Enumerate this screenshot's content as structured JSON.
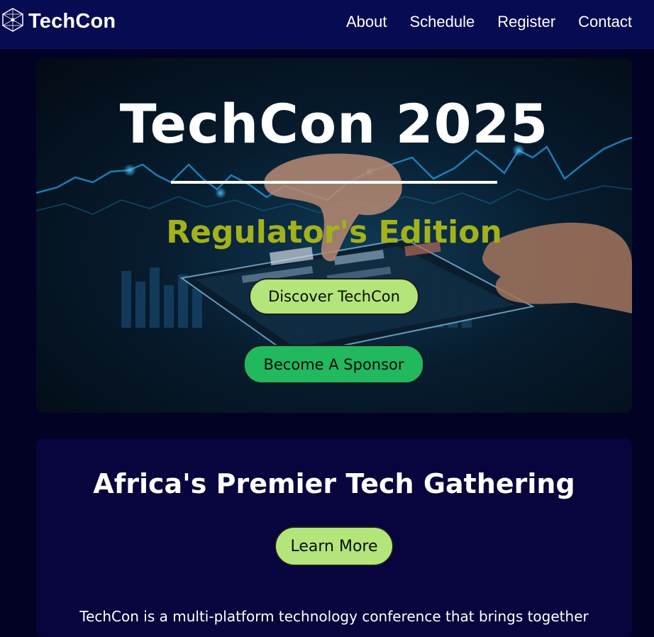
{
  "nav": {
    "logo_icon": "network-hexagon-icon",
    "brand": "TechCon",
    "links": [
      "About",
      "Schedule",
      "Register",
      "Contact"
    ]
  },
  "hero": {
    "title": "TechCon 2025",
    "subtitle": "Regulator's Edition",
    "discover_label": "Discover TechCon",
    "sponsor_label": "Become A Sponsor"
  },
  "about": {
    "title": "Africa's Premier Tech Gathering",
    "learn_label": "Learn More",
    "text": "TechCon is a multi-platform technology conference that brings together"
  },
  "colors": {
    "nav_bg": "#070b52",
    "page_bg": "#020224",
    "accent_green": "#b3e57a",
    "sponsor_green": "#22b85e",
    "subtitle_olive": "#a3b21b"
  }
}
